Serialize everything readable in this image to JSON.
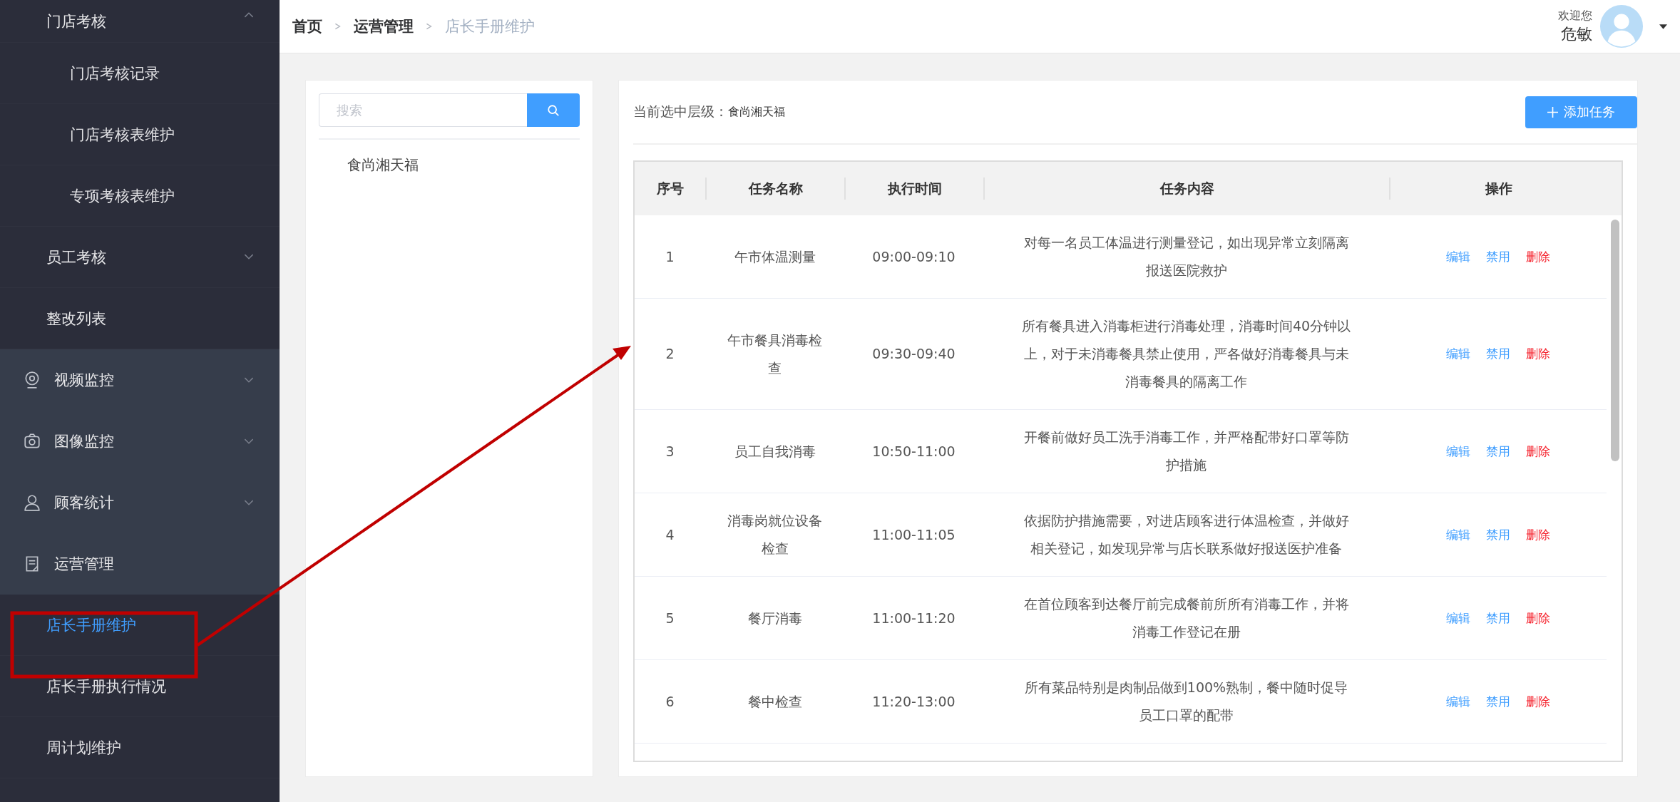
{
  "sidebar": {
    "items": [
      {
        "label": "门店考核",
        "kind": "sub",
        "expanded": true,
        "children": [
          {
            "label": "门店考核记录",
            "selected": false
          },
          {
            "label": "门店考核表维护",
            "selected": false
          },
          {
            "label": "专项考核表维护",
            "selected": false
          }
        ]
      },
      {
        "label": "员工考核",
        "kind": "sub",
        "expanded": false
      },
      {
        "label": "整改列表",
        "kind": "sub"
      },
      {
        "label": "视频监控",
        "kind": "module",
        "expanded": false
      },
      {
        "label": "图像监控",
        "kind": "module",
        "expanded": false
      },
      {
        "label": "顾客统计",
        "kind": "module",
        "expanded": false
      },
      {
        "label": "运营管理",
        "kind": "module",
        "children": [
          {
            "label": "店长手册维护",
            "selected": true
          },
          {
            "label": "店长手册执行情况",
            "selected": false
          },
          {
            "label": "周计划维护",
            "selected": false
          }
        ]
      }
    ]
  },
  "breadcrumb": [
    "首页",
    "运营管理",
    "店长手册维护"
  ],
  "user": {
    "greeting": "欢迎您",
    "name": "危敏"
  },
  "tree_panel": {
    "search": {
      "placeholder": "搜索"
    },
    "nodes": [
      {
        "label": "食尚湘天福",
        "selected": false
      }
    ]
  },
  "task_panel": {
    "level_label": "当前选中层级：",
    "level_value": "食尚湘天福",
    "add_button": "添加任务",
    "table": {
      "columns": [
        "序号",
        "任务名称",
        "执行时间",
        "任务内容",
        "操作"
      ],
      "rows": [
        {
          "index": "1",
          "name": "午市体温测量",
          "time": "09:00-09:10",
          "content": "对每一名员工体温进行测量登记，如出现异常立刻隔离报送医院救护",
          "actions": [
            {
              "label": "编辑",
              "kind": "edit"
            },
            {
              "label": "禁用",
              "kind": "disable"
            },
            {
              "label": "删除",
              "kind": "delete"
            }
          ]
        },
        {
          "index": "2",
          "name": "午市餐具消毒检查",
          "time": "09:30-09:40",
          "content": "所有餐具进入消毒柜进行消毒处理，消毒时间40分钟以上，对于未消毒餐具禁止使用，严各做好消毒餐具与未消毒餐具的隔离工作",
          "actions": [
            {
              "label": "编辑",
              "kind": "edit"
            },
            {
              "label": "禁用",
              "kind": "disable"
            },
            {
              "label": "删除",
              "kind": "delete"
            }
          ]
        },
        {
          "index": "3",
          "name": "员工自我消毒",
          "time": "10:50-11:00",
          "content": "开餐前做好员工洗手消毒工作，并严格配带好口罩等防护措施",
          "actions": [
            {
              "label": "编辑",
              "kind": "edit"
            },
            {
              "label": "禁用",
              "kind": "disable"
            },
            {
              "label": "删除",
              "kind": "delete"
            }
          ]
        },
        {
          "index": "4",
          "name": "消毒岗就位设备检查",
          "time": "11:00-11:05",
          "content": "依据防护措施需要，对进店顾客进行体温检查，并做好相关登记，如发现异常与店长联系做好报送医护准备",
          "actions": [
            {
              "label": "编辑",
              "kind": "edit"
            },
            {
              "label": "禁用",
              "kind": "disable"
            },
            {
              "label": "删除",
              "kind": "delete"
            }
          ]
        },
        {
          "index": "5",
          "name": "餐厅消毒",
          "time": "11:00-11:20",
          "content": "在首位顾客到达餐厅前完成餐前所所有消毒工作，并将消毒工作登记在册",
          "actions": [
            {
              "label": "编辑",
              "kind": "edit"
            },
            {
              "label": "禁用",
              "kind": "disable"
            },
            {
              "label": "删除",
              "kind": "delete"
            }
          ]
        },
        {
          "index": "6",
          "name": "餐中检查",
          "time": "11:20-13:00",
          "content": "所有菜品特别是肉制品做到100%熟制，餐中随时促导员工口罩的配带",
          "actions": [
            {
              "label": "编辑",
              "kind": "edit"
            },
            {
              "label": "禁用",
              "kind": "disable"
            },
            {
              "label": "删除",
              "kind": "delete"
            }
          ]
        }
      ]
    }
  }
}
